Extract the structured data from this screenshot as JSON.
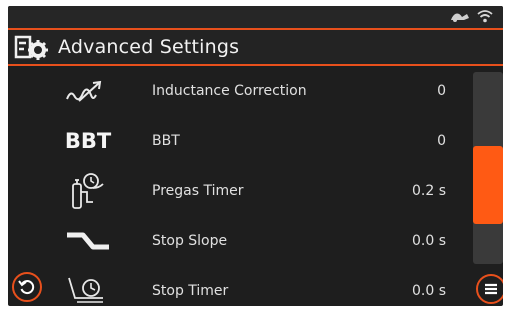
{
  "header": {
    "title": "Advanced Settings",
    "icon": "settings-gear-icon"
  },
  "status": {
    "icons": [
      "wire-feeder-icon",
      "wifi-icon"
    ]
  },
  "rows": [
    {
      "label": "Inductance Correction",
      "value": "0",
      "icon": "inductance-icon"
    },
    {
      "label": "BBT",
      "value": "0",
      "icon": "bbt-icon",
      "icon_text": "BBT"
    },
    {
      "label": "Pregas Timer",
      "value": "0.2 s",
      "icon": "pregas-timer-icon"
    },
    {
      "label": "Stop Slope",
      "value": "0.0 s",
      "icon": "stop-slope-icon"
    },
    {
      "label": "Stop Timer",
      "value": "0.0 s",
      "icon": "stop-timer-icon"
    }
  ],
  "scrollbar": {
    "position_fraction": 0.45
  },
  "colors": {
    "accent": "#e8501c",
    "thumb": "#ff5a14",
    "background": "#1e1e1e"
  },
  "buttons": {
    "back": "undo-icon",
    "menu": "menu-icon"
  }
}
